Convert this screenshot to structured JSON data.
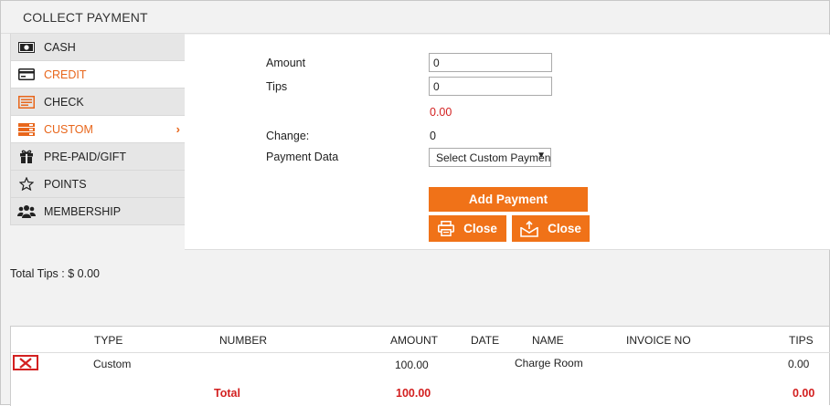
{
  "window": {
    "title": "COLLECT PAYMENT"
  },
  "sidebar": {
    "items": [
      {
        "label": "CASH",
        "icon": "cash-icon"
      },
      {
        "label": "CREDIT",
        "icon": "credit-card-icon"
      },
      {
        "label": "CHECK",
        "icon": "check-icon"
      },
      {
        "label": "CUSTOM",
        "icon": "custom-icon",
        "chevron": "›"
      },
      {
        "label": "PRE-PAID/GIFT",
        "icon": "gift-icon"
      },
      {
        "label": "POINTS",
        "icon": "star-icon"
      },
      {
        "label": "MEMBERSHIP",
        "icon": "group-icon"
      }
    ]
  },
  "form": {
    "amount_label": "Amount",
    "amount_value": "0",
    "tips_label": "Tips",
    "tips_value": "0",
    "balance": "0.00",
    "change_label": "Change:",
    "change_value": "0",
    "payment_data_label": "Payment Data",
    "payment_data_selected": "Select Custom Payment",
    "add_payment_label": "Add Payment",
    "close_print_label": "Close",
    "close_email_label": "Close"
  },
  "total_tips": "Total Tips : $ 0.00",
  "table": {
    "headers": [
      "TYPE",
      "NUMBER",
      "AMOUNT",
      "DATE",
      "NAME",
      "INVOICE NO",
      "TIPS"
    ],
    "rows": [
      {
        "type": "Custom",
        "number": "",
        "amount": "100.00",
        "date": "",
        "name": "Charge Room",
        "invoice_no": "",
        "tips": "0.00"
      }
    ],
    "total": {
      "label": "Total",
      "amount": "100.00",
      "tips": "0.00"
    }
  },
  "colors": {
    "accent": "#f07218",
    "active_text": "#e8661b",
    "error": "#d32020"
  }
}
